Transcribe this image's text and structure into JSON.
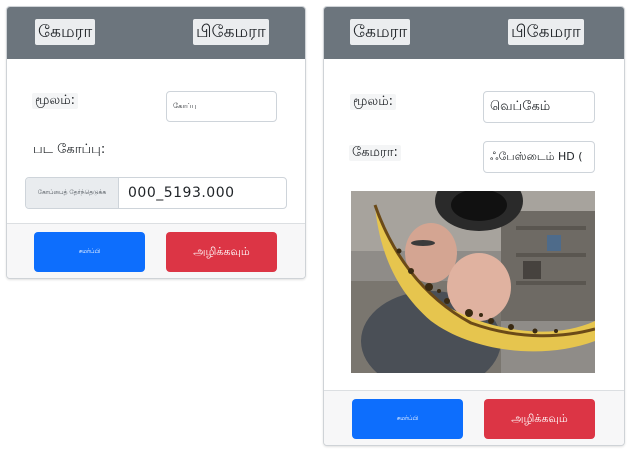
{
  "left_card": {
    "header": {
      "camera_label": "கேமரா",
      "decamera_label": "பிகேமரா"
    },
    "source_label": "மூலம்:",
    "source_value": "கோப்பு",
    "file_label": "பட கோப்பு:",
    "file_button": "கோப்பைத் தேர்ந்தெடுக்க",
    "file_name": "000_5193.000",
    "footer": {
      "submit_label": "சமர்ப்பி",
      "clear_label": "அழிக்கவும்"
    }
  },
  "right_card": {
    "header": {
      "camera_label": "கேமரா",
      "decamera_label": "பிகேமரா"
    },
    "source_label": "மூலம்:",
    "source_value": "வெப்கேம்",
    "camera_label": "கேமரா:",
    "camera_value": "ஃபேஸ்டைம் HD (",
    "webcam_image": "webcam-feed",
    "footer": {
      "submit_label": "சமர்ப்பி",
      "clear_label": "அழிக்கவும்"
    }
  },
  "colors": {
    "header": "#6c757d",
    "primary": "#0d6efd",
    "danger": "#dc3545",
    "footer": "#f7f7f8"
  }
}
